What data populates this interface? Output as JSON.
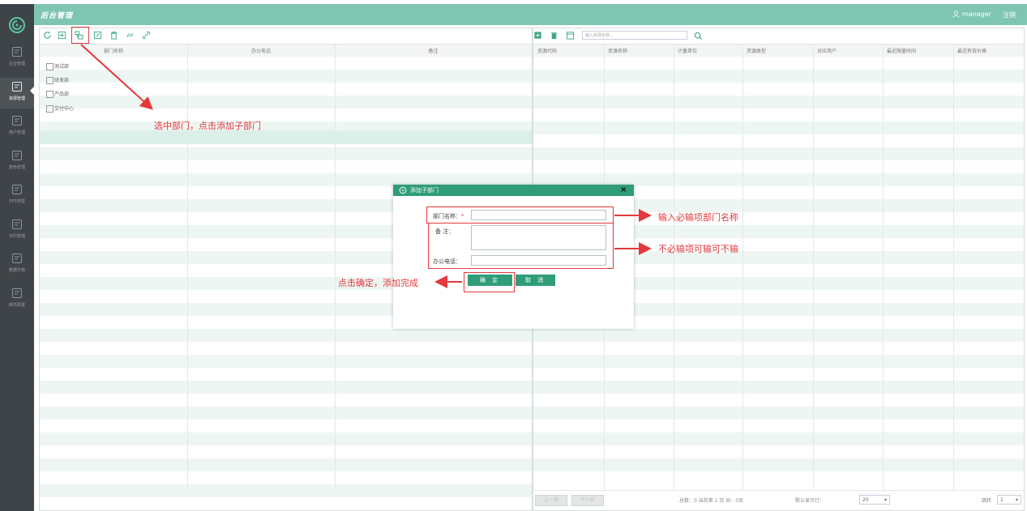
{
  "app": {
    "title": "后台管理",
    "user": "manager",
    "logout": "注销"
  },
  "sidebar": {
    "items": [
      {
        "label": "企业管理",
        "icon": "building-icon"
      },
      {
        "label": "资源管理",
        "icon": "resource-icon",
        "active": true
      },
      {
        "label": "用户管理",
        "icon": "users-icon"
      },
      {
        "label": "角色管理",
        "icon": "role-icon"
      },
      {
        "label": "EPS管理",
        "icon": "eps-icon"
      },
      {
        "label": "日历管理",
        "icon": "calendar-icon"
      },
      {
        "label": "数据字典",
        "icon": "dictionary-icon"
      },
      {
        "label": "邮件配置",
        "icon": "mail-icon"
      }
    ]
  },
  "dept_table": {
    "columns": [
      "部门名称",
      "办公电话",
      "备注"
    ],
    "rows": [
      {
        "name": "测试部"
      },
      {
        "name": "研发部"
      },
      {
        "name": "产品部"
      },
      {
        "name": "交付中心",
        "selected": true
      }
    ]
  },
  "resource_panel": {
    "search_placeholder": "输入资源名称...",
    "columns": [
      "资源代码",
      "资源名称",
      "计量单位",
      "资源类型",
      "对应用户",
      "最近限量时间",
      "最近有效价格"
    ],
    "pager": {
      "prev": "上一页",
      "next": "下一页",
      "summary": "总数：0   当前第 1 页   共：0页",
      "per_page_label": "默认显示行：",
      "per_page": "20",
      "goto_label": "跳转",
      "goto_page": "1"
    }
  },
  "dialog": {
    "title": "添加子部门",
    "close": "×",
    "name_label": "部门名称：",
    "required_mark": "*",
    "remark_label": "备    注：",
    "phone_label": "办公电话：",
    "ok": "确 定",
    "cancel": "取 消"
  },
  "annotations": {
    "select_dept": "选中部门，点击添加子部门",
    "required_field": "输入必输项部门名称",
    "optional_fields": "不必输项可输可不输",
    "confirm": "点击确定，添加完成"
  },
  "colors": {
    "header": "#7fc6b2",
    "sidebar": "#3f4448",
    "dialog_title": "#2f9d79",
    "annotation": "#e4393c"
  }
}
